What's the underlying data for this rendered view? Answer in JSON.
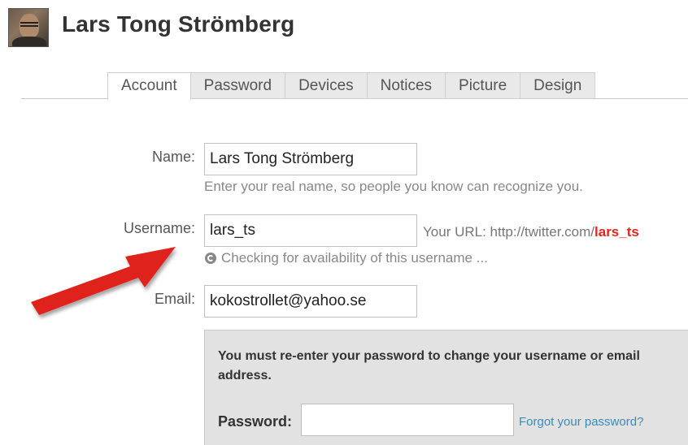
{
  "header": {
    "name": "Lars Tong Strömberg"
  },
  "tabs": [
    {
      "label": "Account",
      "active": true
    },
    {
      "label": "Password",
      "active": false
    },
    {
      "label": "Devices",
      "active": false
    },
    {
      "label": "Notices",
      "active": false
    },
    {
      "label": "Picture",
      "active": false
    },
    {
      "label": "Design",
      "active": false
    }
  ],
  "form": {
    "name_label": "Name:",
    "name_value": "Lars Tong Strömberg",
    "name_hint": "Enter your real name, so people you know can recognize you.",
    "username_label": "Username:",
    "username_value": "lars_ts",
    "url_prefix": "Your URL: http://twitter.com/",
    "url_user": "lars_ts",
    "checking_text": "Checking for availability of this username ...",
    "email_label": "Email:",
    "email_value": "kokostrollet@yahoo.se"
  },
  "password_box": {
    "note": "You must re-enter your password to change your username or email address.",
    "label": "Password:",
    "value": "",
    "forgot_link": "Forgot your password?"
  },
  "colors": {
    "url_user": "#e0251b",
    "link": "#3a8bb5",
    "annotation_arrow": "#e0201a"
  },
  "icons": {
    "avatar": "user-photo",
    "checking": "spinner-icon",
    "annotation": "red-arrow"
  }
}
